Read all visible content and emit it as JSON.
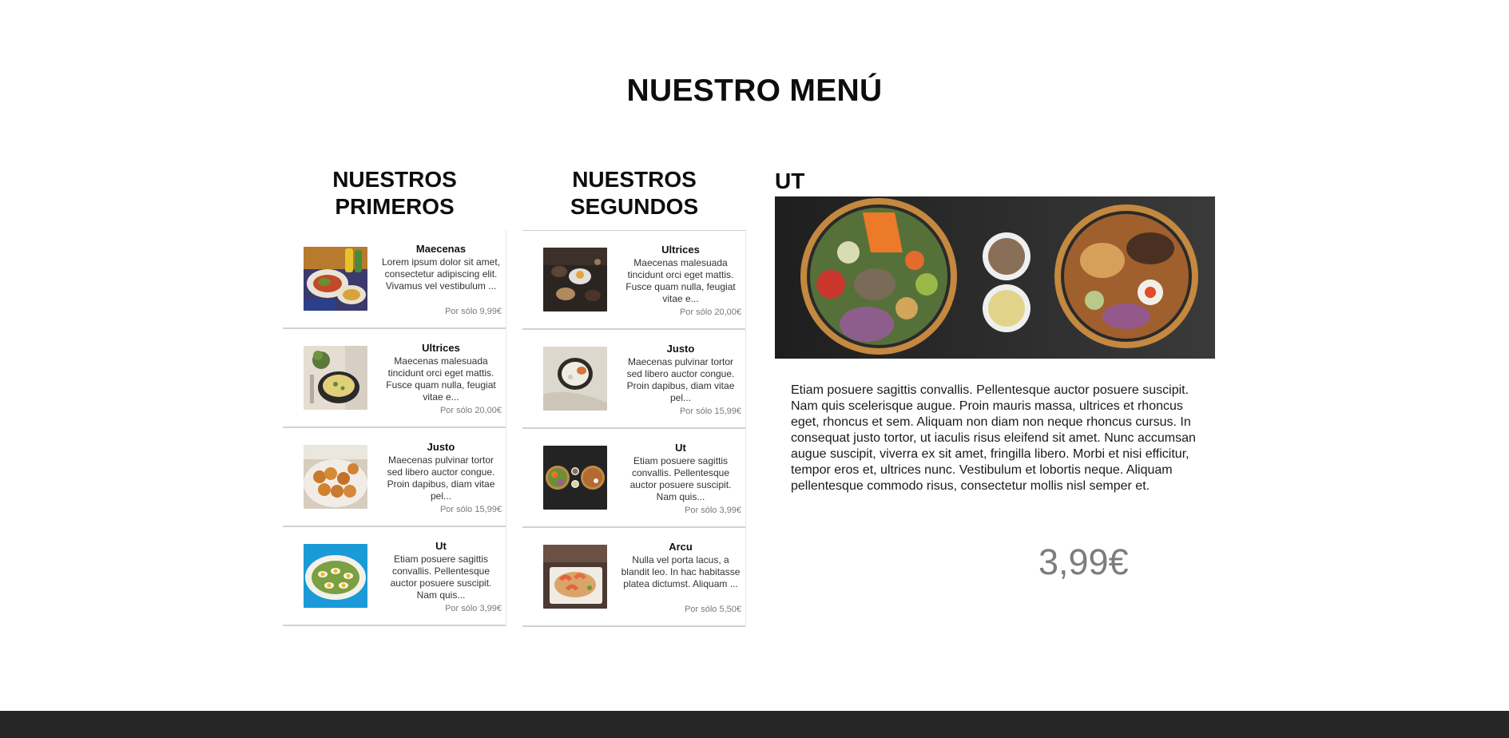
{
  "header": {
    "title": "NUESTRO MENÚ"
  },
  "firsts": {
    "heading_line1": "NUESTROS",
    "heading_line2": "PRIMEROS",
    "items": [
      {
        "name": "Maecenas",
        "desc": "Lorem ipsum dolor sit amet, consectetur adipiscing elit. Vivamus vel vestibulum ...",
        "price": "Por sólo 9,99€",
        "image": "mexican-dishes-photo"
      },
      {
        "name": "Ultrices",
        "desc": "Maecenas malesuada tincidunt orci eget mattis. Fusce quam nulla, feugiat vitae e...",
        "price": "Por sólo 20,00€",
        "image": "soup-bowl-photo"
      },
      {
        "name": "Justo",
        "desc": "Maecenas pulvinar tortor sed libero auctor congue. Proin dapibus, diam vitae pel...",
        "price": "Por sólo 15,99€",
        "image": "fried-balls-photo"
      },
      {
        "name": "Ut",
        "desc": "Etiam posuere sagittis convallis. Pellentesque auctor posuere suscipit. Nam quis...",
        "price": "Por sólo 3,99€",
        "image": "egg-salad-photo"
      }
    ]
  },
  "seconds": {
    "heading_line1": "NUESTROS",
    "heading_line2": "SEGUNDOS",
    "items": [
      {
        "name": "Ultrices",
        "desc": "Maecenas malesuada tincidunt orci eget mattis. Fusce quam nulla, feugiat vitae e...",
        "price": "Por sólo 20,00€",
        "image": "dark-table-dishes-photo"
      },
      {
        "name": "Justo",
        "desc": "Maecenas pulvinar tortor sed libero auctor congue. Proin dapibus, diam vitae pel...",
        "price": "Por sólo 15,99€",
        "image": "rice-bowl-photo"
      },
      {
        "name": "Ut",
        "desc": "Etiam posuere sagittis convallis. Pellentesque auctor posuere suscipit. Nam quis...",
        "price": "Por sólo 3,99€",
        "image": "poke-bowls-photo"
      },
      {
        "name": "Arcu",
        "desc": "Nulla vel porta lacus, a blandit leo. In hac habitasse platea dictumst. Aliquam ...",
        "price": "Por sólo 5,50€",
        "image": "shrimp-noodles-photo"
      }
    ]
  },
  "detail": {
    "title": "UT",
    "image": "poke-bowls-large-photo",
    "text": "Etiam posuere sagittis convallis. Pellentesque auctor posuere suscipit. Nam quis scelerisque augue. Proin mauris massa, ultrices et rhoncus eget, rhoncus et sem. Aliquam non diam non neque rhoncus cursus. In consequat justo tortor, ut iaculis risus eleifend sit amet. Nunc accumsan augue suscipit, viverra ex sit amet, fringilla libero. Morbi et nisi efficitur, tempor eros et, ultrices nunc. Vestibulum et lobortis neque. Aliquam pellentesque commodo risus, consectetur mollis nisl semper et.",
    "price": "3,99€"
  },
  "colors": {
    "footer": "#262626",
    "price_gray": "#7d7d7d"
  }
}
